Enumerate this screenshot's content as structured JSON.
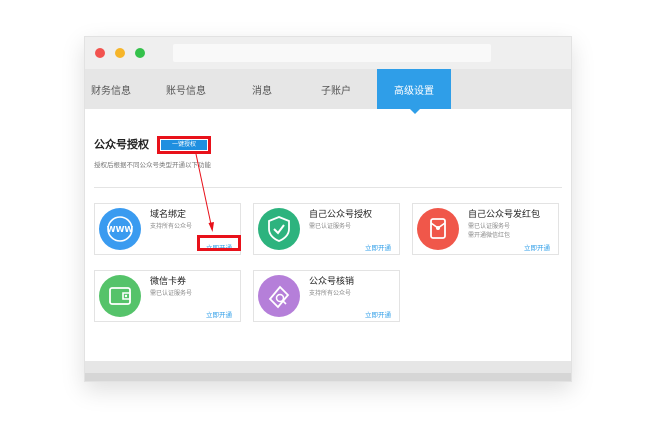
{
  "window": {
    "colors": {
      "close": "#f2534f",
      "minimize": "#f6b529",
      "zoom": "#34c14b",
      "accent": "#2f9ee8",
      "highlight": "#e8111a"
    }
  },
  "tabs": [
    {
      "label": "财务信息",
      "active": false
    },
    {
      "label": "账号信息",
      "active": false
    },
    {
      "label": "消息",
      "active": false
    },
    {
      "label": "子账户",
      "active": false
    },
    {
      "label": "高级设置",
      "active": true
    }
  ],
  "section": {
    "title": "公众号授权",
    "authorize_button": "一键授权",
    "hint": "授权后根据不同公众号类型开通以下功能"
  },
  "cards": [
    {
      "title": "域名绑定",
      "desc": [
        "支持所有公众号"
      ],
      "action": "立即开通",
      "icon": "www-globe-icon",
      "color": "#3a9bf0"
    },
    {
      "title": "自己公众号授权",
      "desc": [
        "需已认证服务号"
      ],
      "action": "立即开通",
      "icon": "shield-check-icon",
      "color": "#2db37e"
    },
    {
      "title": "自己公众号发红包",
      "desc": [
        "需已认证服务号",
        "需开通微信红包"
      ],
      "action": "立即开通",
      "icon": "red-envelope-icon",
      "color": "#f0574a"
    },
    {
      "title": "微信卡券",
      "desc": [
        "需已认证服务号"
      ],
      "action": "立即开通",
      "icon": "wallet-icon",
      "color": "#55c36a"
    },
    {
      "title": "公众号核销",
      "desc": [
        "支持所有公众号"
      ],
      "action": "立即开通",
      "icon": "ticket-search-icon",
      "color": "#b57fd9"
    }
  ]
}
